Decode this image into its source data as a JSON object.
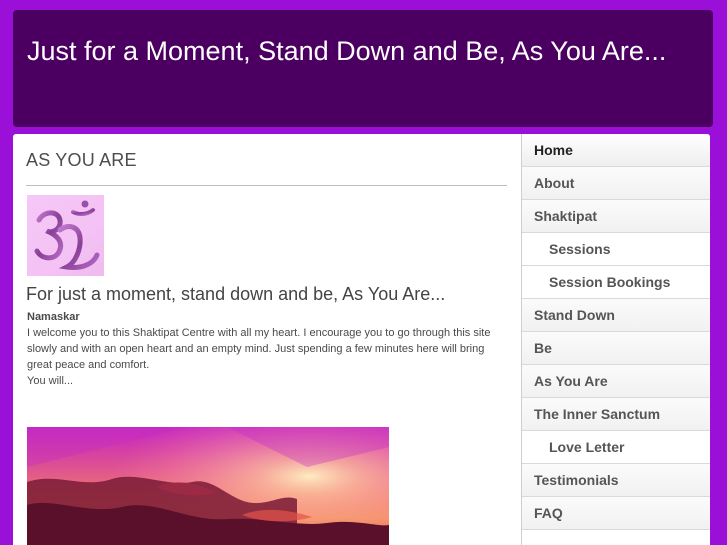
{
  "header": {
    "title": "Just for a Moment, Stand Down and Be, As You Are..."
  },
  "main": {
    "section_title": "AS YOU ARE",
    "subtitle": "For just a moment, stand down and be, As You Are...",
    "greeting": "Namaskar",
    "paragraph": "I welcome you to this Shaktipat Centre with all my heart. I encourage you to go through this site slowly and with an open heart and an empty mind. Just spending a few minutes here will bring great peace and comfort.",
    "closing": "You will..."
  },
  "sidebar": {
    "items": [
      {
        "label": "Home",
        "sub": false,
        "active": true
      },
      {
        "label": "About",
        "sub": false,
        "active": false
      },
      {
        "label": "Shaktipat",
        "sub": false,
        "active": false
      },
      {
        "label": "Sessions",
        "sub": true,
        "active": false
      },
      {
        "label": "Session Bookings",
        "sub": true,
        "active": false
      },
      {
        "label": "Stand Down",
        "sub": false,
        "active": false
      },
      {
        "label": "Be",
        "sub": false,
        "active": false
      },
      {
        "label": "As You Are",
        "sub": false,
        "active": false
      },
      {
        "label": "The Inner Sanctum",
        "sub": false,
        "active": false
      },
      {
        "label": "Love Letter",
        "sub": true,
        "active": false
      },
      {
        "label": "Testimonials",
        "sub": false,
        "active": false
      },
      {
        "label": "FAQ",
        "sub": false,
        "active": false
      }
    ]
  },
  "colors": {
    "page_background": "#9b10d8",
    "header_background": "#4b0061",
    "header_text": "#ffffff"
  }
}
